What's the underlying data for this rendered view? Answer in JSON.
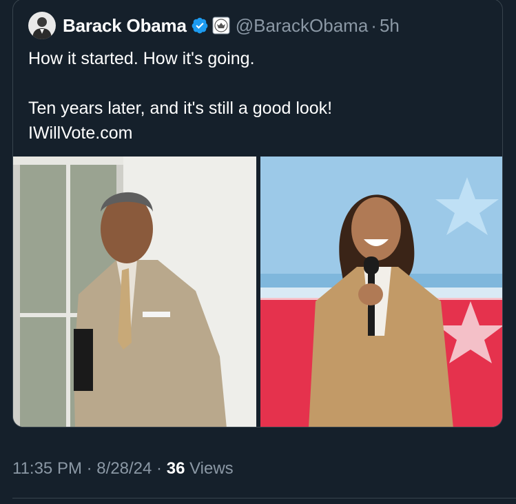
{
  "author": {
    "display_name": "Barack Obama",
    "handle": "@BarackObama",
    "separator": "·",
    "time_ago": "5h",
    "verified_color": "#1d9bf0"
  },
  "tweet": {
    "line1": "How it started. How it's going.",
    "line2": "Ten years later, and it's still a good look!",
    "line3": "IWillVote.com"
  },
  "media": {
    "left_photo": "photo of Barack Obama in a tan suit",
    "right_photo": "photo of Kamala Harris in a tan suit holding a microphone"
  },
  "meta": {
    "time": "11:35 PM",
    "sep1": "·",
    "date": "8/28/24",
    "sep2": "·",
    "views_count": "36",
    "views_label": "Views"
  },
  "colors": {
    "background": "#15202b",
    "text": "#ffffff",
    "secondary": "#8b98a5",
    "border": "#38444d"
  }
}
